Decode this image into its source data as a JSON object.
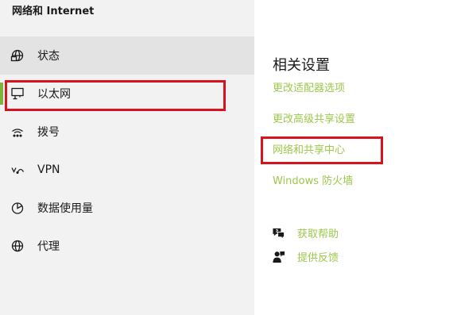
{
  "sidebar": {
    "title": "网络和 Internet",
    "items": [
      {
        "label": "状态",
        "icon": "globe-status-icon"
      },
      {
        "label": "以太网",
        "icon": "ethernet-icon"
      },
      {
        "label": "拨号",
        "icon": "dial-up-icon"
      },
      {
        "label": "VPN",
        "icon": "vpn-icon"
      },
      {
        "label": "数据使用量",
        "icon": "data-usage-icon"
      },
      {
        "label": "代理",
        "icon": "proxy-globe-icon"
      }
    ],
    "selected_index": 1,
    "hovered_index": 0
  },
  "main": {
    "section_title": "相关设置",
    "links": [
      "更改适配器选项",
      "更改高级共享设置",
      "网络和共享中心",
      "Windows 防火墙"
    ],
    "help": {
      "get_help_label": "获取帮助",
      "get_help_icon": "chat-help-icon",
      "feedback_label": "提供反馈",
      "feedback_icon": "feedback-person-icon"
    }
  },
  "colors": {
    "accent": "#7db33a",
    "link": "#9cc84c",
    "highlight_box": "#d7141e",
    "sidebar_bg": "#f2f2f2"
  }
}
